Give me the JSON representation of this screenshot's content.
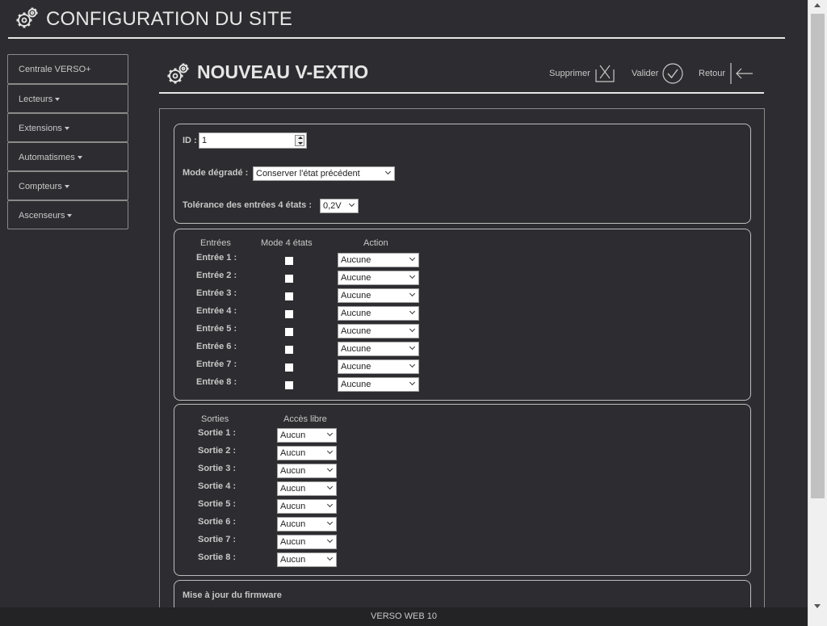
{
  "header": {
    "title": "CONFIGURATION DU SITE"
  },
  "sidebar": {
    "items": [
      {
        "label": "Centrale VERSO+",
        "dropdown": false
      },
      {
        "label": "Lecteurs",
        "dropdown": true
      },
      {
        "label": "Extensions",
        "dropdown": true
      },
      {
        "label": "Automatismes",
        "dropdown": true
      },
      {
        "label": "Compteurs",
        "dropdown": true
      },
      {
        "label": "Ascenseurs",
        "dropdown": true
      }
    ]
  },
  "page": {
    "title": "NOUVEAU V-EXTIO",
    "actions": {
      "delete": "Supprimer",
      "validate": "Valider",
      "back": "Retour"
    }
  },
  "general": {
    "id_label": "ID :",
    "id_value": "1",
    "mode_label": "Mode dégradé :",
    "mode_value": "Conserver l'état précédent",
    "tol_label": "Tolérance des entrées 4 états :",
    "tol_value": "0,2V"
  },
  "inputs": {
    "col_inputs": "Entrées",
    "col_mode": "Mode 4 états",
    "col_action": "Action",
    "rows": [
      {
        "label": "Entrée 1 :",
        "action": "Aucune"
      },
      {
        "label": "Entrée 2 :",
        "action": "Aucune"
      },
      {
        "label": "Entrée 3 :",
        "action": "Aucune"
      },
      {
        "label": "Entrée 4 :",
        "action": "Aucune"
      },
      {
        "label": "Entrée 5 :",
        "action": "Aucune"
      },
      {
        "label": "Entrée 6 :",
        "action": "Aucune"
      },
      {
        "label": "Entrée 7 :",
        "action": "Aucune"
      },
      {
        "label": "Entrée 8 :",
        "action": "Aucune"
      }
    ]
  },
  "outputs": {
    "col_outputs": "Sorties",
    "col_access": "Accès libre",
    "rows": [
      {
        "label": "Sortie 1 :",
        "access": "Aucun"
      },
      {
        "label": "Sortie 2 :",
        "access": "Aucun"
      },
      {
        "label": "Sortie 3 :",
        "access": "Aucun"
      },
      {
        "label": "Sortie 4 :",
        "access": "Aucun"
      },
      {
        "label": "Sortie 5 :",
        "access": "Aucun"
      },
      {
        "label": "Sortie 6 :",
        "access": "Aucun"
      },
      {
        "label": "Sortie 7 :",
        "access": "Aucun"
      },
      {
        "label": "Sortie 8 :",
        "access": "Aucun"
      }
    ]
  },
  "firmware": {
    "label": "Mise à jour du firmware"
  },
  "footer": {
    "text": "VERSO WEB 10"
  }
}
